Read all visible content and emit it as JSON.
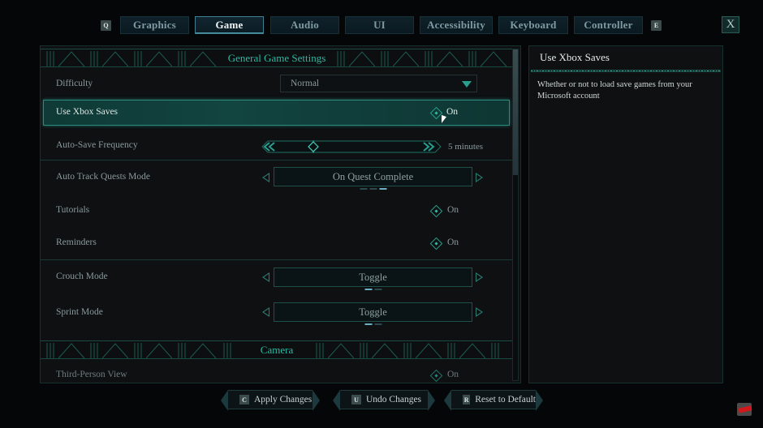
{
  "tabs": {
    "prev_key": "Q",
    "next_key": "E",
    "items": [
      {
        "label": "Graphics",
        "active": false
      },
      {
        "label": "Game",
        "active": true
      },
      {
        "label": "Audio",
        "active": false
      },
      {
        "label": "UI",
        "active": false
      },
      {
        "label": "Accessibility",
        "active": false
      },
      {
        "label": "Keyboard",
        "active": false
      },
      {
        "label": "Controller",
        "active": false
      }
    ],
    "close_label": "X"
  },
  "settings": {
    "section_general": "General Game Settings",
    "section_camera": "Camera",
    "difficulty": {
      "label": "Difficulty",
      "value": "Normal"
    },
    "use_xbox_saves": {
      "label": "Use Xbox Saves",
      "value": "On"
    },
    "auto_save": {
      "label": "Auto-Save Frequency",
      "value": "5 minutes",
      "slider_fraction": 0.25
    },
    "auto_track": {
      "label": "Auto Track Quests Mode",
      "value": "On Quest Complete",
      "option_index": 3,
      "option_count": 3
    },
    "tutorials": {
      "label": "Tutorials",
      "value": "On"
    },
    "reminders": {
      "label": "Reminders",
      "value": "On"
    },
    "crouch_mode": {
      "label": "Crouch Mode",
      "value": "Toggle",
      "option_index": 1,
      "option_count": 2
    },
    "sprint_mode": {
      "label": "Sprint Mode",
      "value": "Toggle",
      "option_index": 1,
      "option_count": 2
    },
    "third_person": {
      "label": "Third-Person View",
      "value": "On"
    }
  },
  "description": {
    "title": "Use Xbox Saves",
    "text": "Whether or not to load save games from your Microsoft account"
  },
  "actions": [
    {
      "key": "C",
      "label": "Apply Changes"
    },
    {
      "key": "U",
      "label": "Undo Changes"
    },
    {
      "key": "R",
      "label": "Reset to Default"
    }
  ],
  "colors": {
    "accent": "#2fb8a4",
    "selected_row": "#124440",
    "background": "#0e1012"
  }
}
